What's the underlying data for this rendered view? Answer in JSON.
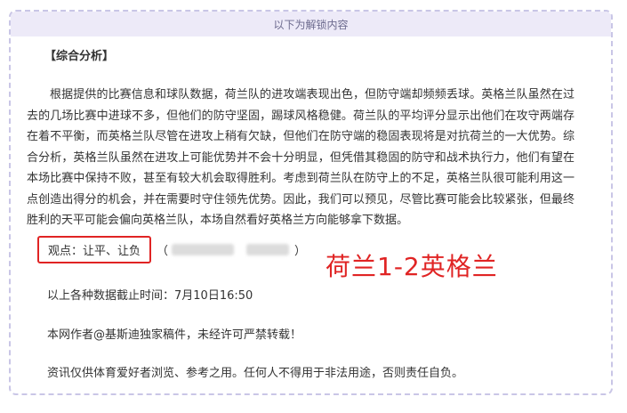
{
  "header": {
    "title": "以下为解锁内容"
  },
  "section": {
    "title": "【综合分析】"
  },
  "analysis": {
    "paragraph": "根据提供的比赛信息和球队数据，荷兰队的进攻端表现出色，但防守端却频频丢球。英格兰队虽然在过去的几场比赛中进球不多，但他们的防守坚固，踢球风格稳健。荷兰队的平均评分显示出他们在攻守两端存在着不平衡，而英格兰队尽管在进攻上稍有欠缺，但他们在防守端的稳固表现将是对抗荷兰的一大优势。综合分析，英格兰队虽然在进攻上可能优势并不会十分明显，但凭借其稳固的防守和战术执行力，他们有望在本场比赛中保持不败，甚至有较大机会取得胜利。考虑到荷兰队在防守上的不足，英格兰队很可能利用这一点创造出得分的机会，并在需要时守住领先优势。因此，我们可以预见，尽管比赛可能会比较紧张，但最终胜利的天平可能会偏向英格兰队，本场自然看好英格兰方向能够拿下数据。"
  },
  "opinion": {
    "label": "观点：让平、让负",
    "paren_open": "（",
    "paren_close": "）"
  },
  "prediction": {
    "text": "荷兰1-2英格兰",
    "color": "#e02424"
  },
  "footer": {
    "deadline": "以上各种数据截止时间：7月10日16:50",
    "copyright": "本网作者@基斯迪独家稿件，未经许可严禁转载！",
    "disclaimer": "资讯仅供体育爱好者浏览、参考之用。任何人不得用于非法用途，否则责任自负。"
  },
  "colors": {
    "accent_red": "#e02424",
    "header_bg": "#edeaf8",
    "border": "#c9c6e6"
  }
}
